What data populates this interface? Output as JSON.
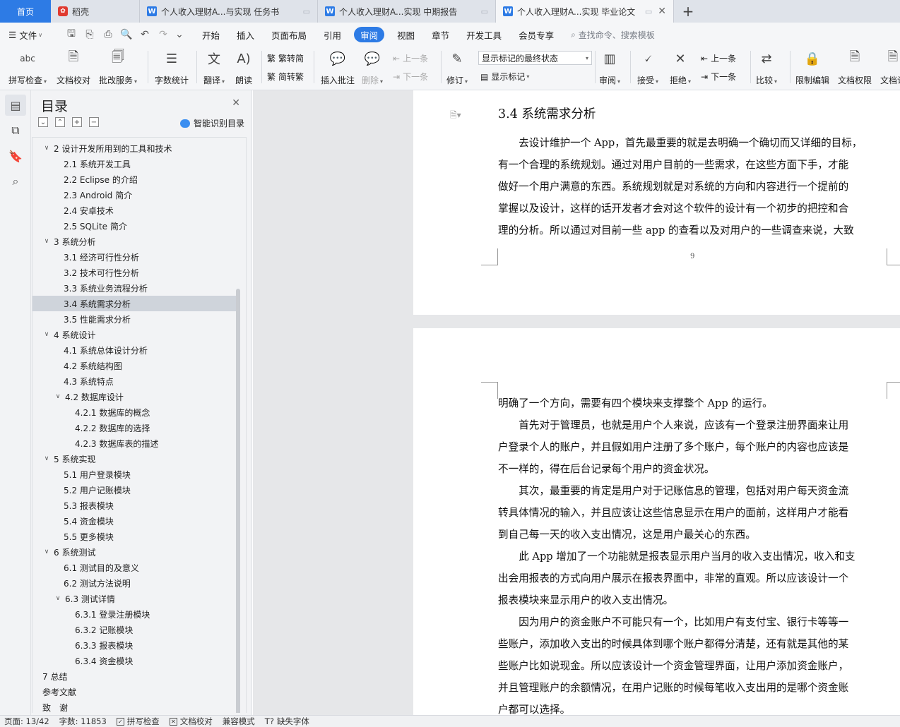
{
  "tabs": {
    "home": "首页",
    "daoke": "稻壳",
    "doc1": "个人收入理财A...与实现 任务书",
    "doc2": "个人收入理财A...实现 中期报告",
    "doc3": "个人收入理财A...实现 毕业论文",
    "doc_icon": "W",
    "new_tab": "+"
  },
  "menubar": {
    "file": "文件",
    "items": [
      "开始",
      "插入",
      "页面布局",
      "引用",
      "审阅",
      "视图",
      "章节",
      "开发工具",
      "会员专享"
    ],
    "active": "审阅",
    "search": "查找命令、搜索模板"
  },
  "ribbon": {
    "spell": "拼写检查",
    "doccheck": "文档校对",
    "batch": "批改服务",
    "wordcount": "字数统计",
    "translate": "翻译",
    "read": "朗读",
    "trad": "繁转简",
    "simp": "简转繁",
    "insert_comment": "插入批注",
    "delete": "删除",
    "prev_comment": "上一条",
    "next_comment": "下一条",
    "revise": "修订",
    "mark_state": "显示标记的最终状态",
    "show_mark": "显示标记",
    "review": "审阅",
    "accept": "接受",
    "reject": "拒绝",
    "prev_change": "上一条",
    "next_change": "下一条",
    "compare": "比较",
    "restrict": "限制编辑",
    "rights": "文档权限",
    "docmore": "文档认"
  },
  "nav": {
    "title": "目录",
    "smart": "智能识别目录",
    "toc": [
      {
        "level": 1,
        "text": "2 设计开发所用到的工具和技术",
        "collapsible": true
      },
      {
        "level": 2,
        "text": "2.1 系统开发工具"
      },
      {
        "level": 2,
        "text": "2.2 Eclipse 的介绍"
      },
      {
        "level": 2,
        "text": "2.3 Android 简介"
      },
      {
        "level": 2,
        "text": "2.4 安卓技术"
      },
      {
        "level": 2,
        "text": "2.5 SQLite 简介"
      },
      {
        "level": 1,
        "text": "3 系统分析",
        "collapsible": true
      },
      {
        "level": 2,
        "text": "3.1  经济可行性分析"
      },
      {
        "level": 2,
        "text": "3.2  技术可行性分析"
      },
      {
        "level": 2,
        "text": "3.3  系统业务流程分析"
      },
      {
        "level": 2,
        "text": "3.4  系统需求分析",
        "selected": true
      },
      {
        "level": 2,
        "text": "3.5  性能需求分析"
      },
      {
        "level": 1,
        "text": "4 系统设计",
        "collapsible": true
      },
      {
        "level": 2,
        "text": "4.1 系统总体设计分析"
      },
      {
        "level": 2,
        "text": "4.2 系统结构图"
      },
      {
        "level": 2,
        "text": "4.3 系统特点"
      },
      {
        "level": 2,
        "text": "4.2 数据库设计",
        "collapsible": true
      },
      {
        "level": 3,
        "text": "4.2.1 数据库的概念"
      },
      {
        "level": 3,
        "text": "4.2.2 数据库的选择"
      },
      {
        "level": 3,
        "text": "4.2.3 数据库表的描述"
      },
      {
        "level": 1,
        "text": "5 系统实现",
        "collapsible": true
      },
      {
        "level": 2,
        "text": "5.1 用户登录模块"
      },
      {
        "level": 2,
        "text": "5.2 用户记账模块"
      },
      {
        "level": 2,
        "text": "5.3 报表模块"
      },
      {
        "level": 2,
        "text": "5.4 资金模块"
      },
      {
        "level": 2,
        "text": "5.5 更多模块"
      },
      {
        "level": 1,
        "text": "6 系统测试",
        "collapsible": true
      },
      {
        "level": 2,
        "text": "6.1 测试目的及意义"
      },
      {
        "level": 2,
        "text": "6.2 测试方法说明"
      },
      {
        "level": 2,
        "text": "6.3 测试详情",
        "collapsible": true
      },
      {
        "level": 3,
        "text": "6.3.1  登录注册模块"
      },
      {
        "level": 3,
        "text": "6.3.2  记账模块"
      },
      {
        "level": 3,
        "text": "6.3.3  报表模块"
      },
      {
        "level": 3,
        "text": "6.3.4  资金模块"
      },
      {
        "level": 1,
        "text": "7 总结"
      },
      {
        "level": 1,
        "text": "参考文献"
      },
      {
        "level": 1,
        "text": "致　谢"
      }
    ]
  },
  "doc": {
    "heading": "3.4  系统需求分析",
    "page1_lines": [
      "　　去设计维护一个 App，首先最重要的就是去明确一个确切而又详细的目标，",
      "有一个合理的系统规划。通过对用户目前的一些需求，在这些方面下手，才能",
      "做好一个用户满意的东西。系统规划就是对系统的方向和内容进行一个提前的",
      "掌握以及设计，这样的话开发者才会对这个软件的设计有一个初步的把控和合",
      "理的分析。所以通过对目前一些 app 的查看以及对用户的一些调查来说，大致"
    ],
    "page_number": "9",
    "page2_lines": [
      "明确了一个方向，需要有四个模块来支撑整个 App 的运行。",
      "　　首先对于管理员，也就是用户个人来说，应该有一个登录注册界面来让用",
      "户登录个人的账户，并且假如用户注册了多个账户，每个账户的内容也应该是",
      "不一样的，得在后台记录每个用户的资金状况。",
      "　　其次，最重要的肯定是用户对于记账信息的管理，包括对用户每天资金流",
      "转具体情况的输入，并且应该让这些信息显示在用户的面前，这样用户才能看",
      "到自己每一天的收入支出情况，这是用户最关心的东西。",
      "　　此 App 增加了一个功能就是报表显示用户当月的收入支出情况，收入和支",
      "出会用报表的方式向用户展示在报表界面中，非常的直观。所以应该设计一个",
      "报表模块来显示用户的收入支出情况。",
      "　　因为用户的资金账户不可能只有一个，比如用户有支付宝、银行卡等等一",
      "些账户，添加收入支出的时候具体到哪个账户都得分清楚，还有就是其他的某",
      "些账户比如说现金。所以应该设计一个资金管理界面，让用户添加资金账户，",
      "并且管理账户的余额情况，在用户记账的时候每笔收入支出用的是哪个资金账",
      "户都可以选择。"
    ]
  },
  "status": {
    "page": "页面: 13/42",
    "words": "字数: 11853",
    "spell": "拼写检查",
    "proof": "文档校对",
    "compat": "兼容模式",
    "font": "缺失字体"
  },
  "colors": {
    "accent": "#2d7be5",
    "selected_row": "#cfd4db"
  }
}
